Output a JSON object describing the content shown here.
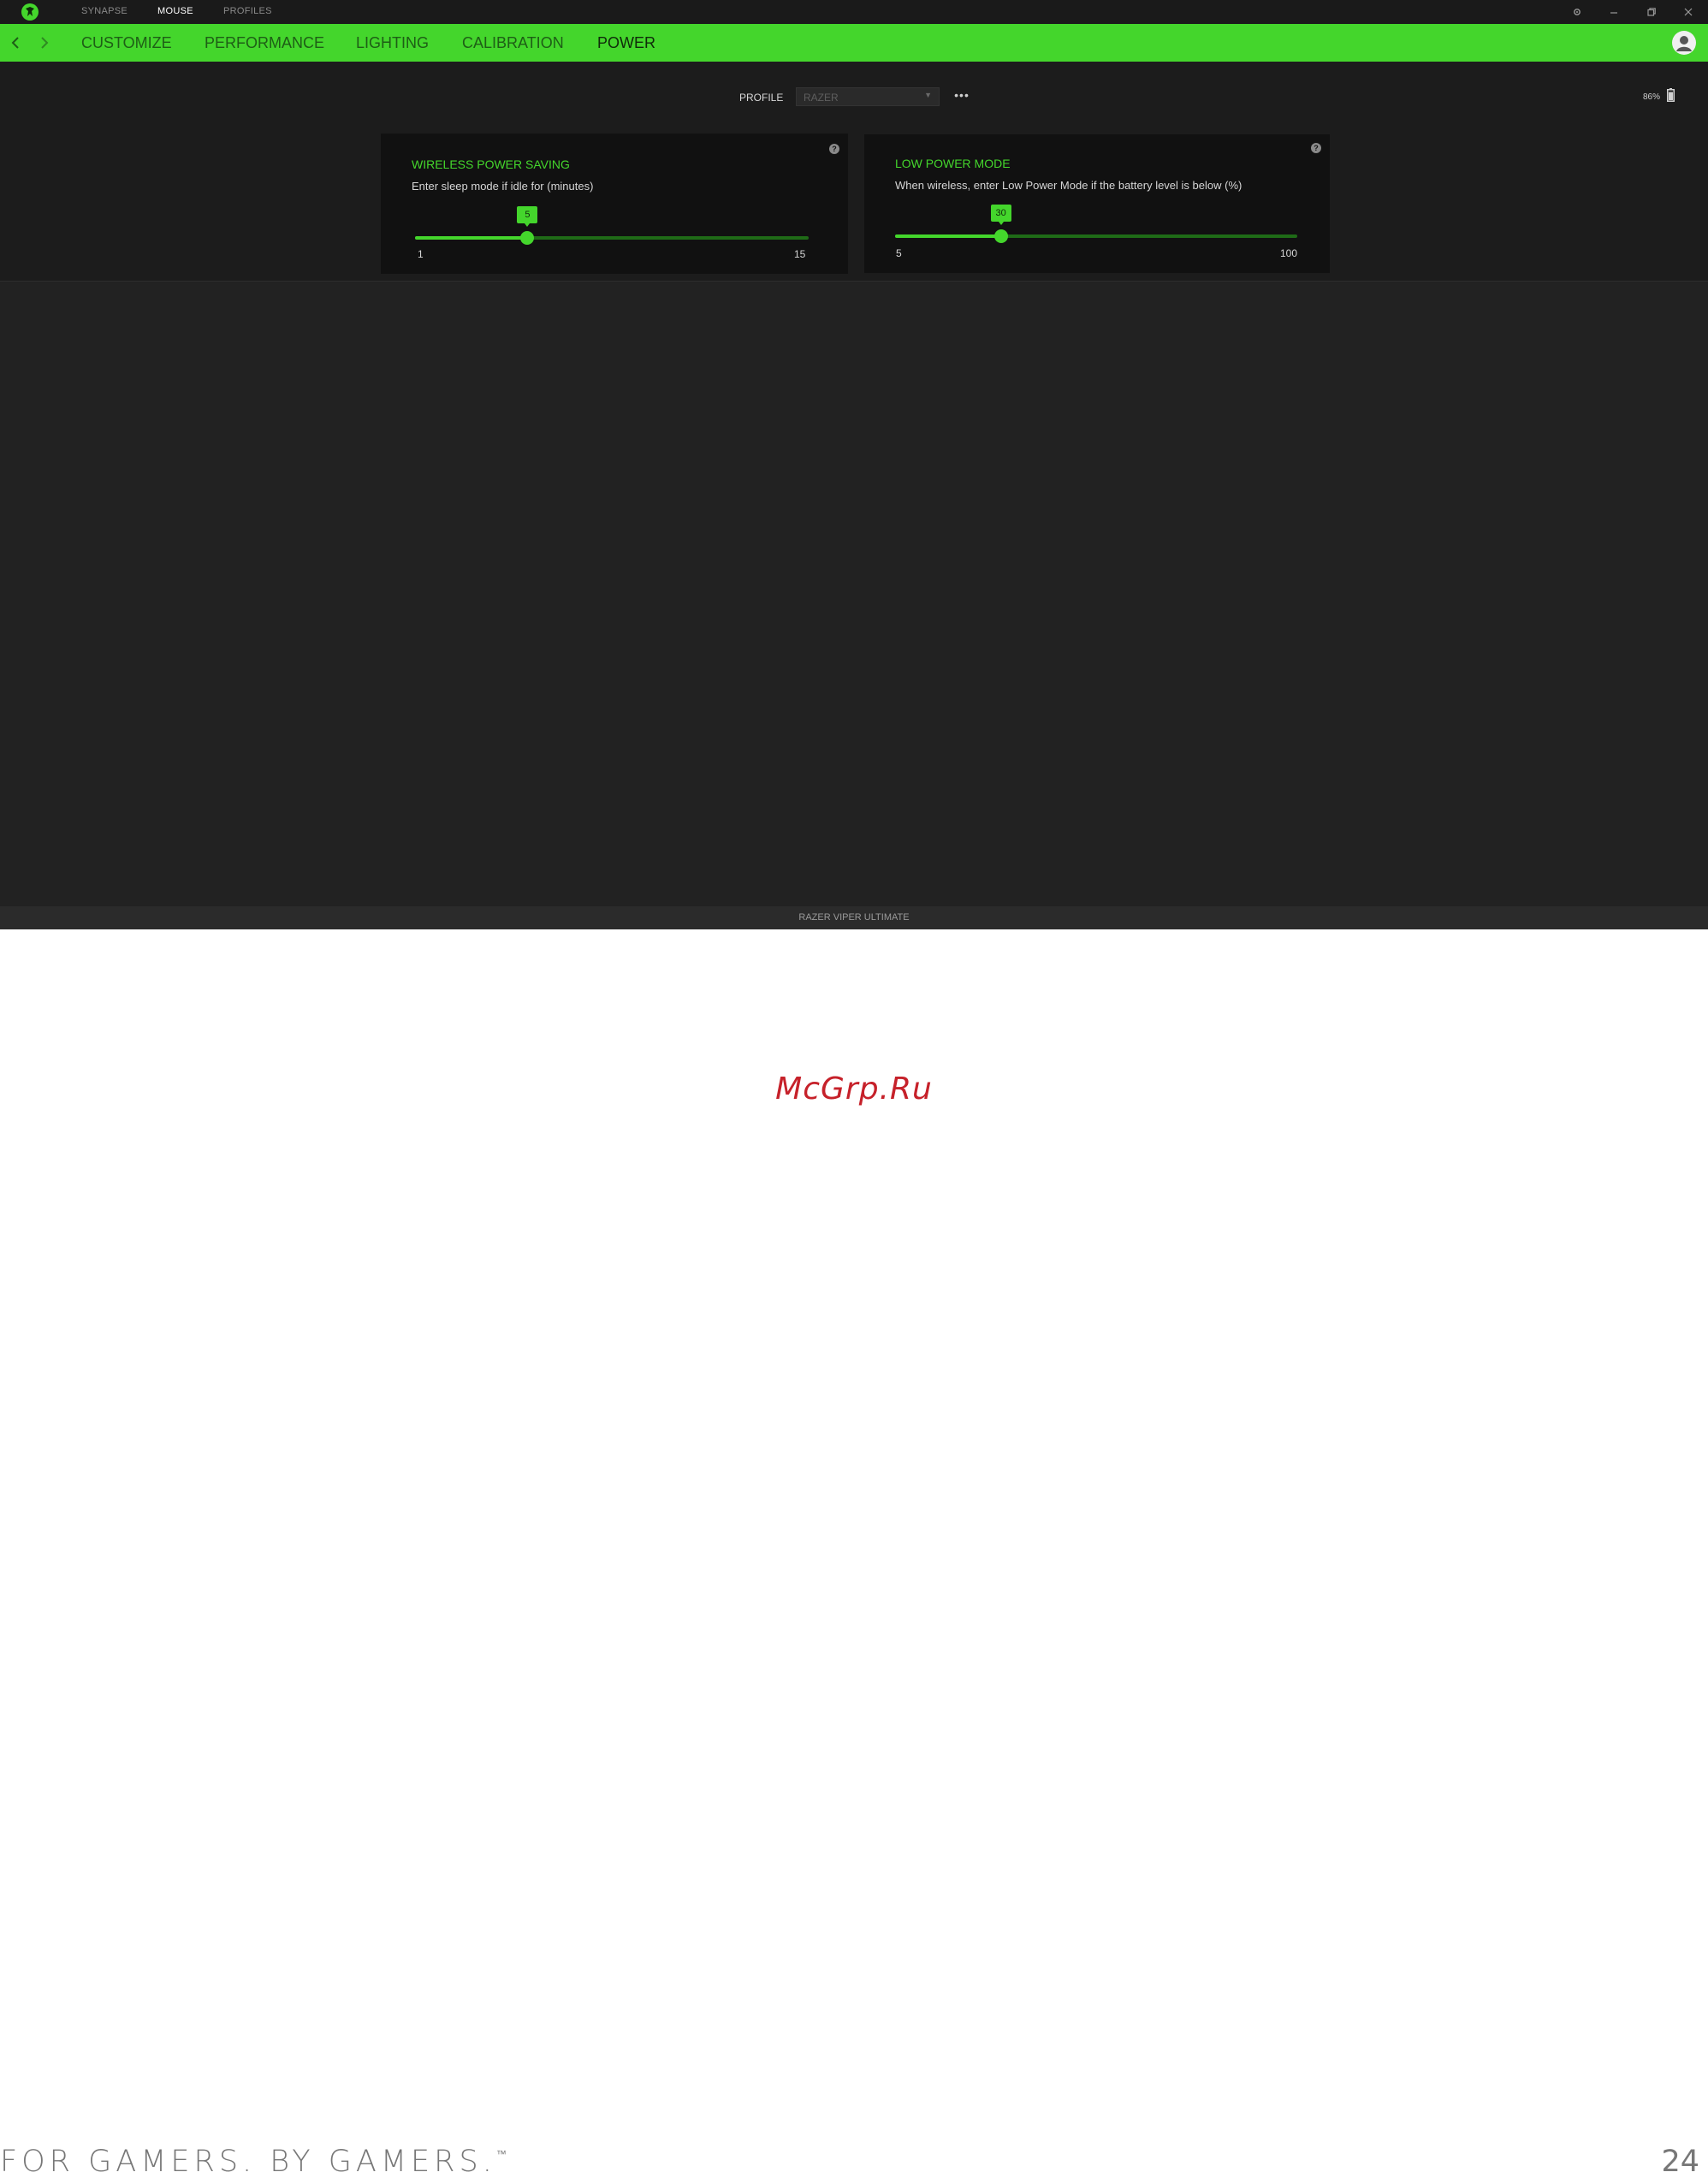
{
  "titlebar": {
    "tabs": [
      {
        "label": "SYNAPSE",
        "active": false
      },
      {
        "label": "MOUSE",
        "active": true
      },
      {
        "label": "PROFILES",
        "active": false
      }
    ],
    "window_controls": [
      "settings-icon",
      "minimize-icon",
      "restore-icon",
      "close-icon"
    ]
  },
  "navbar": {
    "tabs": [
      {
        "label": "CUSTOMIZE",
        "active": false
      },
      {
        "label": "PERFORMANCE",
        "active": false
      },
      {
        "label": "LIGHTING",
        "active": false
      },
      {
        "label": "CALIBRATION",
        "active": false
      },
      {
        "label": "POWER",
        "active": true
      }
    ]
  },
  "profile": {
    "label": "PROFILE",
    "selected": "RAZER",
    "more_label": "•••"
  },
  "battery": {
    "text": "86%",
    "level": 0.86
  },
  "cards": {
    "wireless_power_saving": {
      "title": "WIRELESS POWER SAVING",
      "description": "Enter sleep mode if idle for (minutes)",
      "value": "5",
      "min": "1",
      "max": "15"
    },
    "low_power_mode": {
      "title": "LOW POWER MODE",
      "description": "When wireless, enter Low Power Mode if the battery level is below (%)",
      "value": "30",
      "min": "5",
      "max": "100"
    },
    "help_label": "?"
  },
  "statusbar": {
    "device_name": "RAZER VIPER ULTIMATE"
  },
  "page": {
    "watermark": "McGrp.Ru",
    "slogan": "FOR GAMERS. BY GAMERS.",
    "trademark": "™",
    "page_number": "24"
  },
  "colors": {
    "accent": "#44d62c",
    "background": "#222222",
    "card": "#111111",
    "watermark": "#c6212a"
  }
}
